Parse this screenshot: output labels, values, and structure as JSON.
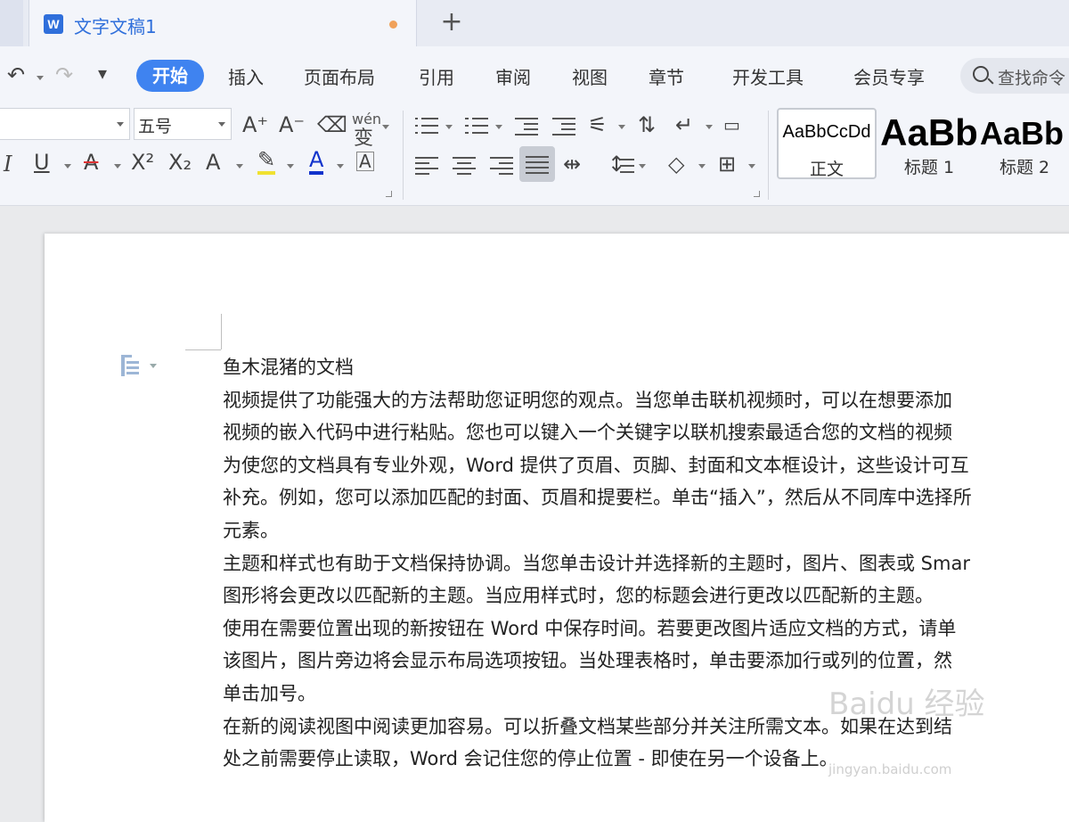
{
  "tab": {
    "icon_letter": "W",
    "title": "文字文稿1",
    "new_tab": "+"
  },
  "quick_access": {
    "undo": "↶",
    "redo": "↷",
    "customize": "▾"
  },
  "menu": [
    {
      "label": "开始",
      "active": true
    },
    {
      "label": "插入"
    },
    {
      "label": "页面布局"
    },
    {
      "label": "引用"
    },
    {
      "label": "审阅"
    },
    {
      "label": "视图"
    },
    {
      "label": "章节"
    },
    {
      "label": "开发工具"
    },
    {
      "label": "会员专享"
    }
  ],
  "search": {
    "placeholder": "查找命令"
  },
  "font": {
    "name": "",
    "size": "五号"
  },
  "ribbon_icons": {
    "grow_font": "A⁺",
    "shrink_font": "A⁻",
    "clear_format": "⌫",
    "pinyin": "wén",
    "italic": "I",
    "underline": "U",
    "strikethrough": "A",
    "superscript": "X²",
    "subscript": "X₂",
    "text_effect": "A",
    "highlight": "✎",
    "font_color": "A",
    "char_border": "A"
  },
  "styles": [
    {
      "preview": "AaBbCcDd",
      "name": "正文"
    },
    {
      "preview": "AaBb",
      "name": "标题 1"
    },
    {
      "preview": "AaBb",
      "name": "标题 2"
    }
  ],
  "document": {
    "lines": [
      "鱼木混猪的文档",
      "视频提供了功能强大的方法帮助您证明您的观点。当您单击联机视频时，可以在想要添加",
      "视频的嵌入代码中进行粘贴。您也可以键入一个关键字以联机搜索最适合您的文档的视频",
      "为使您的文档具有专业外观，Word 提供了页眉、页脚、封面和文本框设计，这些设计可互",
      "补充。例如，您可以添加匹配的封面、页眉和提要栏。单击“插入”，然后从不同库中选择所",
      "元素。",
      "主题和样式也有助于文档保持协调。当您单击设计并选择新的主题时，图片、图表或 Smar",
      "图形将会更改以匹配新的主题。当应用样式时，您的标题会进行更改以匹配新的主题。",
      "使用在需要位置出现的新按钮在 Word 中保存时间。若要更改图片适应文档的方式，请单",
      "该图片，图片旁边将会显示布局选项按钮。当处理表格时，单击要添加行或列的位置，然",
      "单击加号。",
      "在新的阅读视图中阅读更加容易。可以折叠文档某些部分并关注所需文本。如果在达到结",
      "处之前需要停止读取，Word 会记住您的停止位置 - 即使在另一个设备上。"
    ]
  },
  "watermark": {
    "text": "Baidu 经验",
    "sub": "jingyan.baidu.com"
  }
}
